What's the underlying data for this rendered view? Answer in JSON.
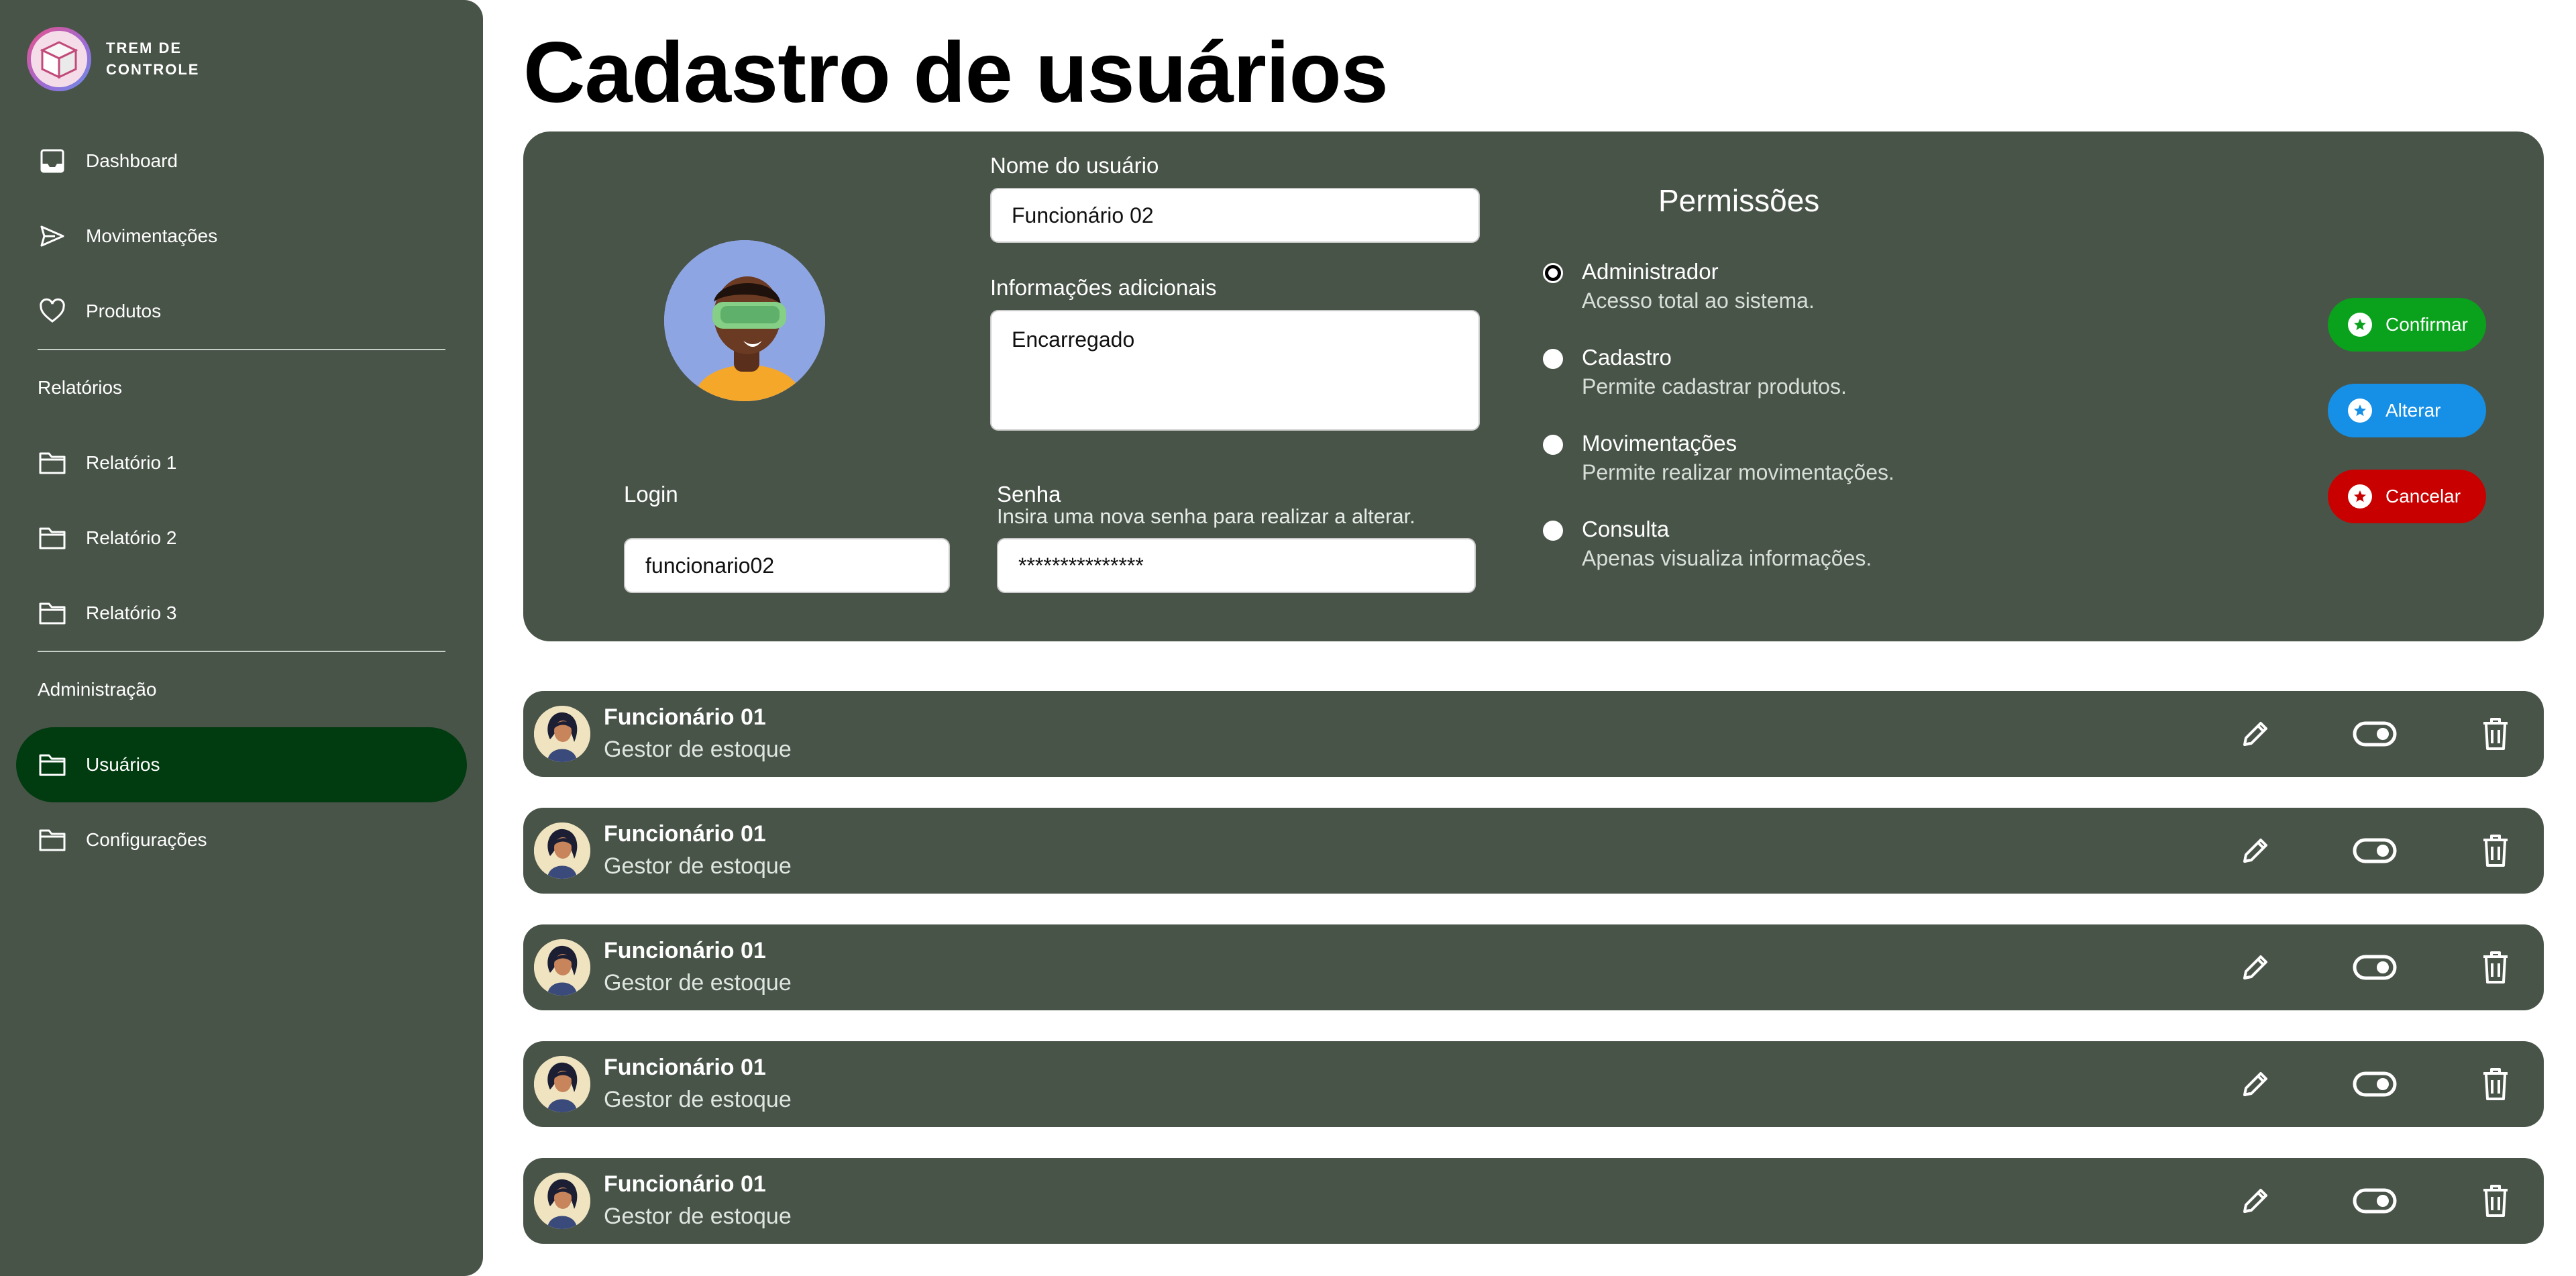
{
  "brand": {
    "name_line1": "TREM DE",
    "name_line2": "CONTROLE"
  },
  "sidebar": {
    "items": [
      {
        "label": "Dashboard",
        "icon": "inbox-icon"
      },
      {
        "label": "Movimentações",
        "icon": "send-icon"
      },
      {
        "label": "Produtos",
        "icon": "heart-icon"
      }
    ],
    "section_reports": "Relatórios",
    "reports": [
      {
        "label": "Relatório 1",
        "icon": "folder-icon"
      },
      {
        "label": "Relatório 2",
        "icon": "folder-icon"
      },
      {
        "label": "Relatório 3",
        "icon": "folder-icon"
      }
    ],
    "section_admin": "Administração",
    "admin": [
      {
        "label": "Usuários",
        "icon": "folder-icon",
        "active": true
      },
      {
        "label": "Configurações",
        "icon": "folder-icon"
      }
    ]
  },
  "page": {
    "title": "Cadastro de usuários"
  },
  "form": {
    "name_label": "Nome do usuário",
    "name_value": "Funcionário 02",
    "info_label": "Informações adicionais",
    "info_value": "Encarregado",
    "login_label": "Login",
    "login_value": "funcionario02",
    "password_label": "Senha",
    "password_hint": "Insira uma nova senha para realizar a alterar.",
    "password_value": "***************"
  },
  "permissions": {
    "title": "Permissões",
    "options": [
      {
        "name": "Administrador",
        "desc": "Acesso total ao sistema.",
        "checked": true
      },
      {
        "name": "Cadastro",
        "desc": "Permite cadastrar produtos.",
        "checked": false
      },
      {
        "name": "Movimentações",
        "desc": "Permite realizar movimentações.",
        "checked": false
      },
      {
        "name": "Consulta",
        "desc": "Apenas visualiza informações.",
        "checked": false
      }
    ]
  },
  "actions": {
    "confirm": "Confirmar",
    "alter": "Alterar",
    "cancel": "Cancelar",
    "colors": {
      "confirm": "#0aa11c",
      "alter": "#1590e6",
      "cancel": "#c90000"
    }
  },
  "users": [
    {
      "name": "Funcionário 01",
      "role": "Gestor de estoque"
    },
    {
      "name": "Funcionário 01",
      "role": "Gestor de estoque"
    },
    {
      "name": "Funcionário 01",
      "role": "Gestor de estoque"
    },
    {
      "name": "Funcionário 01",
      "role": "Gestor de estoque"
    },
    {
      "name": "Funcionário 01",
      "role": "Gestor de estoque"
    }
  ],
  "row_icons": [
    "pencil-icon",
    "toggle-icon",
    "trash-icon"
  ],
  "colors": {
    "sidebar": "#495449",
    "active_nav": "#013b10",
    "card": "#495449"
  }
}
